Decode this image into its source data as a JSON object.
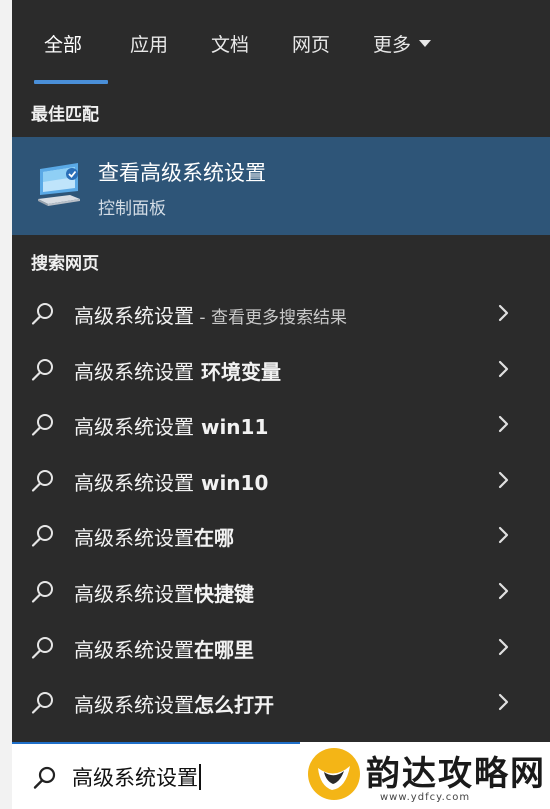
{
  "tabs": [
    "全部",
    "应用",
    "文档",
    "网页",
    "更多"
  ],
  "best_match": {
    "section_title": "最佳匹配",
    "title": "查看高级系统设置",
    "subtitle": "控制面板",
    "icon": "computer-settings-icon"
  },
  "web": {
    "section_title": "搜索网页",
    "items": [
      {
        "main": "高级系统设置",
        "extra": " - 查看更多搜索结果"
      },
      {
        "main": "高级系统设置",
        "extra": " 环境变量"
      },
      {
        "main": "高级系统设置",
        "extra": " win11"
      },
      {
        "main": "高级系统设置",
        "extra": " win10"
      },
      {
        "main": "高级系统设置",
        "extra": "在哪"
      },
      {
        "main": "高级系统设置",
        "extra": "快捷键"
      },
      {
        "main": "高级系统设置",
        "extra": "在哪里"
      },
      {
        "main": "高级系统设置",
        "extra": "怎么打开"
      }
    ]
  },
  "search": {
    "value": "高级系统设置"
  },
  "watermark": {
    "text": "韵达攻略网",
    "url": "www.ydfcy.com"
  },
  "colors": {
    "panel": "#2b2b2b",
    "accent": "#4a8fd8",
    "best_bg": "#2e5578"
  }
}
